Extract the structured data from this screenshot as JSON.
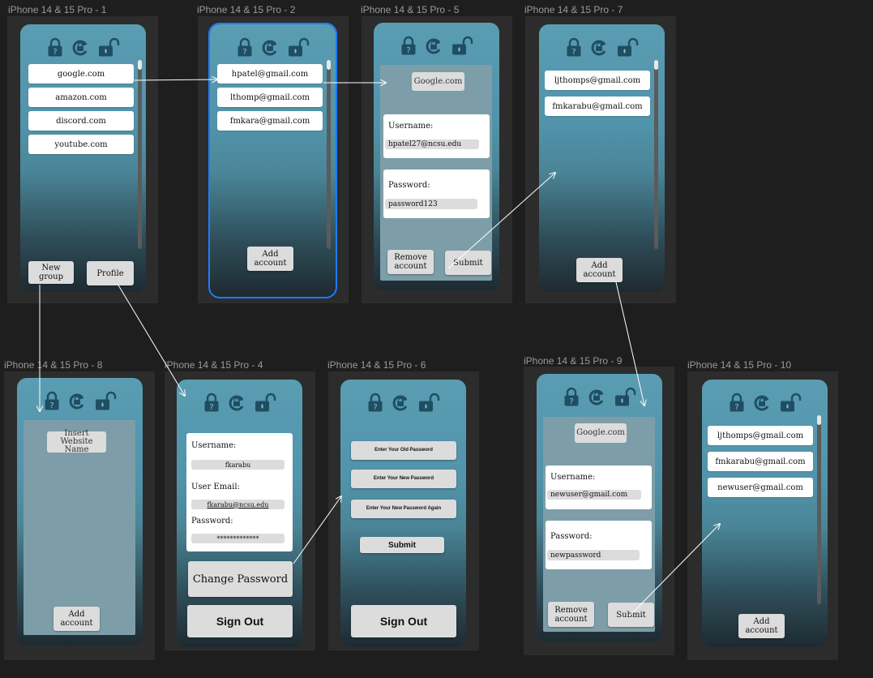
{
  "frames": {
    "f1": {
      "title": "iPhone 14 & 15 Pro - 1"
    },
    "f2": {
      "title": "iPhone 14 & 15 Pro - 2"
    },
    "f5": {
      "title": "iPhone 14 & 15 Pro - 5"
    },
    "f7": {
      "title": "iPhone 14 & 15 Pro - 7"
    },
    "f8": {
      "title": "iPhone 14 & 15 Pro - 8"
    },
    "f4": {
      "title": "iPhone 14 & 15 Pro - 4"
    },
    "f6": {
      "title": "iPhone 14 & 15 Pro - 6"
    },
    "f9": {
      "title": "iPhone 14 & 15 Pro - 9"
    },
    "f10": {
      "title": "iPhone 14 & 15 Pro - 10"
    }
  },
  "icons": [
    "lock-help-icon",
    "refresh-lock-icon",
    "unlock-icon"
  ],
  "screen1": {
    "sites": [
      "google.com",
      "amazon.com",
      "discord.com",
      "youtube.com"
    ],
    "new_group": "New group",
    "profile": "Profile"
  },
  "screen2": {
    "accounts": [
      "hpatel@gmail.com",
      "lthomp@gmail.com",
      "fmkara@gmail.com"
    ],
    "add_account": "Add account"
  },
  "screen5": {
    "site": "Google.com",
    "username_label": "Username:",
    "username_value": "hpatel27@ncsu.edu",
    "password_label": "Password:",
    "password_value": "password123",
    "remove": "Remove account",
    "submit": "Submit"
  },
  "screen7": {
    "accounts": [
      "ljthomps@gmail.com",
      "fmkarabu@gmail.com"
    ],
    "add_account": "Add account"
  },
  "screen8": {
    "placeholder": "Insert Website Name",
    "add_account": "Add account"
  },
  "screen4": {
    "username_label": "Username:",
    "username_value": "fkarabu",
    "email_label": "User Email:",
    "email_value": "fkarabu@ncsu.edu",
    "password_label": "Password:",
    "password_value": "*************",
    "change_password": "Change Password",
    "sign_out": "Sign Out"
  },
  "screen6": {
    "old_password": "Enter Your Old Password",
    "new_password": "Enter Your New Password",
    "new_password_again": "Enter Your New Password Again",
    "submit": "Submit",
    "sign_out": "Sign Out"
  },
  "screen9": {
    "site": "Google.com",
    "username_label": "Username:",
    "username_value": "newuser@gmail.com",
    "password_label": "Password:",
    "password_value": "newpassword",
    "remove": "Remove account",
    "submit": "Submit"
  },
  "screen10": {
    "accounts": [
      "ljthomps@gmail.com",
      "fmkarabu@gmail.com",
      "newuser@gmail.com"
    ],
    "add_account": "Add account"
  },
  "colors": {
    "canvas": "#1e1e1e",
    "frame_bg": "#2c2c2c",
    "phone_top": "#5a9db3",
    "phone_bottom": "#1e2a31",
    "selection": "#1e7bff",
    "button": "#dcdcdc"
  }
}
